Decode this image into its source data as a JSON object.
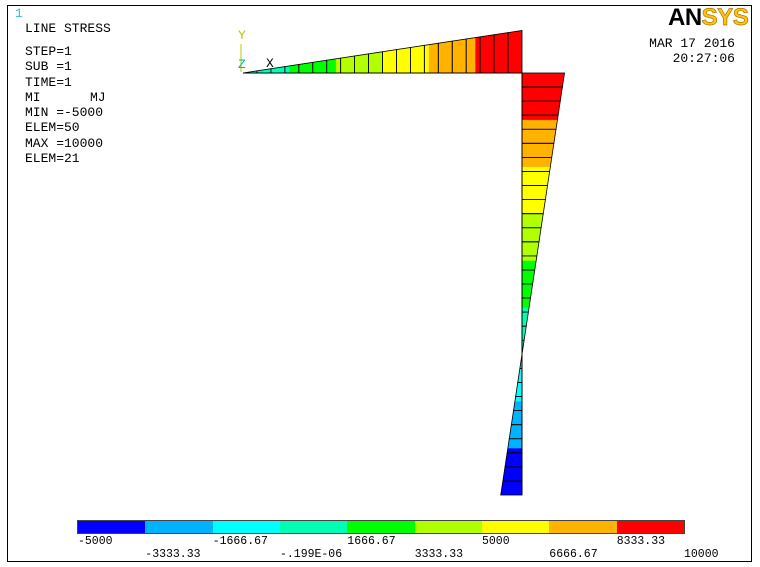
{
  "window": {
    "number": "1",
    "number_color": "#34B8FF"
  },
  "legend_text": {
    "title": "LINE STRESS",
    "step": "STEP=1",
    "sub": "SUB =1",
    "time": "TIME=1",
    "mi": "MI",
    "mj": "MJ",
    "min": "MIN =-5000",
    "min_elem": "ELEM=50",
    "max": "MAX =10000",
    "max_elem": "ELEM=21"
  },
  "logo": {
    "an": "AN",
    "sys": "SYS",
    "an_color": "#000000",
    "sys_color": "#FFC20E"
  },
  "timestamp": {
    "date": "MAR 17 2016",
    "time": "20:27:06"
  },
  "triad": {
    "y": "Y",
    "z": "Z",
    "x": "X",
    "y_color": "#B4C800",
    "z_color": "#00B894",
    "x_color": "#000000"
  },
  "contour": {
    "colors": [
      "#0000FF",
      "#00B2FF",
      "#00FFFF",
      "#00FFB2",
      "#00FF00",
      "#B2FF00",
      "#FFFF00",
      "#FFB200",
      "#FF0000"
    ],
    "labels": [
      "-5000",
      "-3333.33",
      "-1666.67",
      "-.199E-06",
      "1666.67",
      "3333.33",
      "5000",
      "6666.67",
      "8333.33",
      "10000"
    ]
  },
  "diagram": {
    "beam_node_values": [
      0,
      500,
      1000,
      1500,
      2000,
      2500,
      3000,
      3500,
      4000,
      4500,
      5000,
      5500,
      6000,
      6500,
      7000,
      7500,
      8000,
      8500,
      9000,
      9500,
      10000
    ],
    "column_node_values": [
      10000,
      9500,
      9000,
      8500,
      8000,
      7500,
      7000,
      6500,
      6000,
      5500,
      5000,
      4500,
      4000,
      3500,
      3000,
      2500,
      2000,
      1500,
      1000,
      500,
      0,
      -500,
      -1000,
      -1500,
      -2000,
      -2500,
      -3000,
      -3500,
      -4000,
      -4500,
      -5000
    ]
  }
}
